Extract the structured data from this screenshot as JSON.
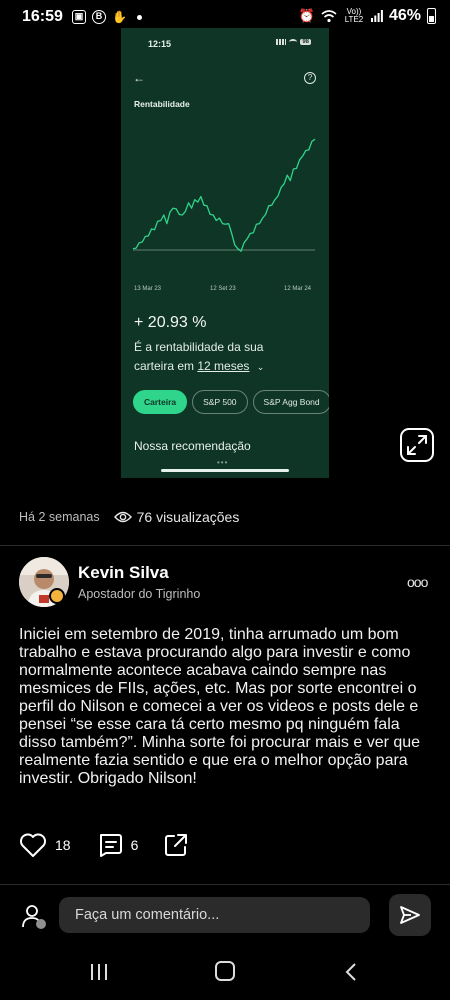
{
  "status_bar": {
    "time": "16:59",
    "battery": "46%",
    "network": "Vo)) LTE2",
    "left_icons": [
      "gallery-icon",
      "b-icon",
      "hand-icon"
    ],
    "right_icons": [
      "alarm-icon",
      "wifi-icon",
      "signal-icon",
      "battery-icon"
    ]
  },
  "screenshot": {
    "time": "12:15",
    "battery": "98",
    "title": "Rentabilidade",
    "x_labels": [
      "13 Mar 23",
      "12 Set 23",
      "12 Mar 24"
    ],
    "return_value": "+ 20.93 %",
    "desc_line1": "É a rentabilidade da sua",
    "desc_line2_prefix": "carteira em",
    "period": "12 meses",
    "chevron": "⌄",
    "pills": [
      "Carteira",
      "S&P 500",
      "S&P Agg Bond"
    ],
    "active_pill": "Carteira",
    "recommendation": "Nossa recomendação",
    "accent_color": "#2fd58a",
    "background_color": "#0f3526"
  },
  "chart_data": {
    "type": "line",
    "title": "Rentabilidade",
    "x_tick_labels": [
      "13 Mar 23",
      "12 Set 23",
      "12 Mar 24"
    ],
    "series": [
      {
        "values": [
          0,
          1,
          2,
          3,
          4,
          5,
          6.5,
          7,
          9,
          10,
          11,
          9,
          12,
          14,
          13,
          12,
          11,
          13,
          15,
          14,
          16,
          16,
          17,
          15,
          14,
          12,
          11,
          10,
          10,
          9,
          8,
          9,
          5,
          2,
          0,
          0,
          2,
          4,
          5,
          6,
          8,
          9,
          10,
          12,
          14,
          15,
          16,
          18,
          20,
          22,
          24,
          23,
          26,
          27,
          29,
          31,
          32,
          33,
          35,
          36.5
        ]
      }
    ],
    "baseline": 0,
    "grid": false,
    "legend": "none"
  },
  "post": {
    "time_ago": "Há 2 semanas",
    "views": "76 visualizações",
    "author_name": "Kevin Silva",
    "author_subtitle": "Apostador do Tigrinho",
    "more": "ooo",
    "body": "Iniciei em setembro de 2019, tinha arrumado um bom trabalho e estava procurando algo para investir e como normalmente acontece acabava caindo sempre nas mesmices de FIIs, ações, etc. Mas por sorte encontrei o perfil do Nilson e comecei a ver os videos e posts dele e pensei “se esse cara tá certo mesmo pq ninguém fala disso também?”. Minha sorte foi procurar mais e ver que realmente fazia sentido e que era o melhor opção para investir. Obrigado Nilson!",
    "likes": "18",
    "comments": "6"
  },
  "comment_bar": {
    "placeholder": "Faça um comentário..."
  }
}
